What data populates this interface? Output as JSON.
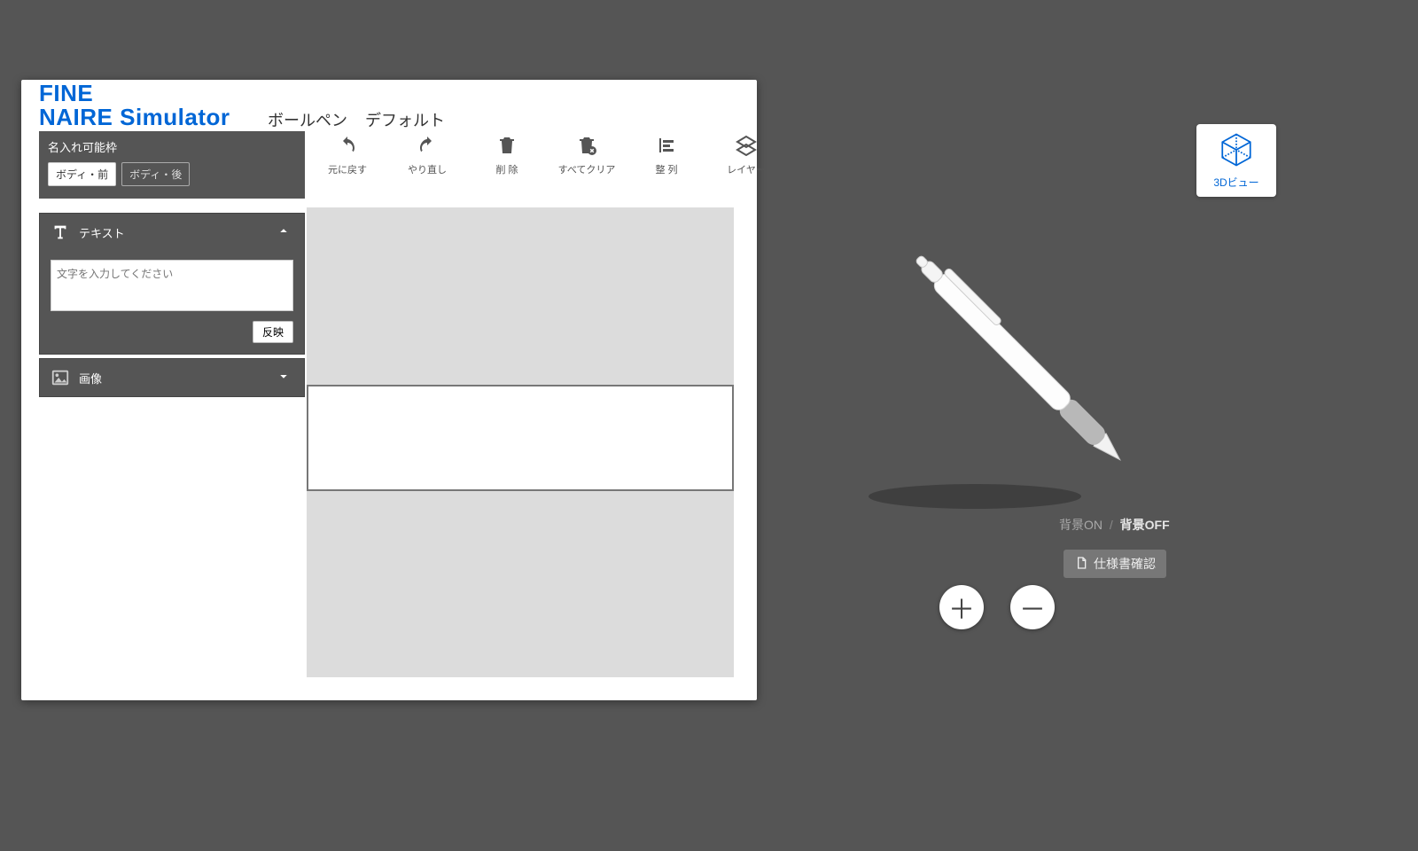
{
  "brand": {
    "line1": "FINE",
    "line2": "NAIRE Simulator"
  },
  "product": {
    "name": "ボールペン",
    "variant": "デフォルト"
  },
  "framebox": {
    "title": "名入れ可能枠",
    "front": "ボディ・前",
    "back": "ボディ・後"
  },
  "toolbar": {
    "undo": "元に戻す",
    "redo": "やり直し",
    "delete": "削 除",
    "clear_all": "すべてクリア",
    "align": "整 列",
    "layer": "レイヤー"
  },
  "panels": {
    "text": {
      "title": "テキスト",
      "placeholder": "文字を入力してください",
      "apply": "反映"
    },
    "image": {
      "title": "画像"
    }
  },
  "view3d": {
    "label": "3Dビュー"
  },
  "background": {
    "on": "背景ON",
    "off": "背景OFF"
  },
  "spec": {
    "label": "仕様書確認"
  },
  "zoom": {
    "in": "＋",
    "out": "－"
  }
}
